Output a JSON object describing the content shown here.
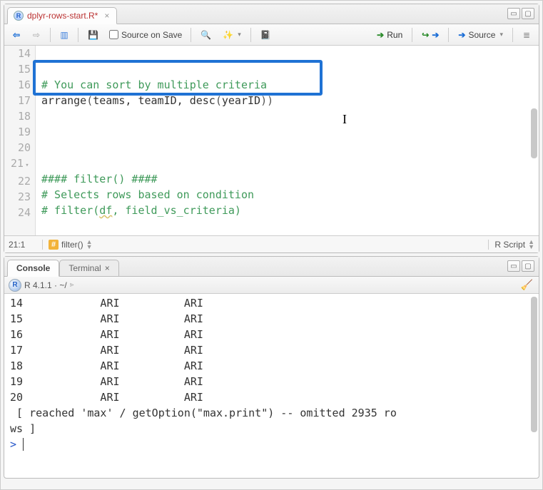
{
  "editor": {
    "tab": {
      "filename": "dplyr-rows-start.R*"
    },
    "toolbar": {
      "source_on_save": "Source on Save",
      "run": "Run",
      "source": "Source"
    },
    "lines": [
      {
        "n": "14",
        "text": ""
      },
      {
        "n": "15",
        "text": "# You can sort by multiple criteria"
      },
      {
        "n": "16",
        "text": "arrange(teams, teamID, desc(yearID))"
      },
      {
        "n": "17",
        "text": ""
      },
      {
        "n": "18",
        "text": ""
      },
      {
        "n": "19",
        "text": ""
      },
      {
        "n": "20",
        "text": ""
      },
      {
        "n": "21",
        "text": "#### filter() ####"
      },
      {
        "n": "22",
        "text": "# Selects rows based on condition"
      },
      {
        "n": "23",
        "text": "# filter(df, field_vs_criteria)"
      },
      {
        "n": "24",
        "text": ""
      }
    ],
    "status": {
      "pos": "21:1",
      "crumb": "filter()",
      "lang": "R Script"
    }
  },
  "console": {
    "tabs": {
      "console": "Console",
      "terminal": "Terminal"
    },
    "header": "R 4.1.1 · ~/",
    "rows": [
      {
        "n": "14",
        "a": "ARI",
        "b": "ARI"
      },
      {
        "n": "15",
        "a": "ARI",
        "b": "ARI"
      },
      {
        "n": "16",
        "a": "ARI",
        "b": "ARI"
      },
      {
        "n": "17",
        "a": "ARI",
        "b": "ARI"
      },
      {
        "n": "18",
        "a": "ARI",
        "b": "ARI"
      },
      {
        "n": "19",
        "a": "ARI",
        "b": "ARI"
      },
      {
        "n": "20",
        "a": "ARI",
        "b": "ARI"
      }
    ],
    "trailer": " [ reached 'max' / getOption(\"max.print\") -- omitted 2935 rows ]",
    "prompt": "> "
  }
}
